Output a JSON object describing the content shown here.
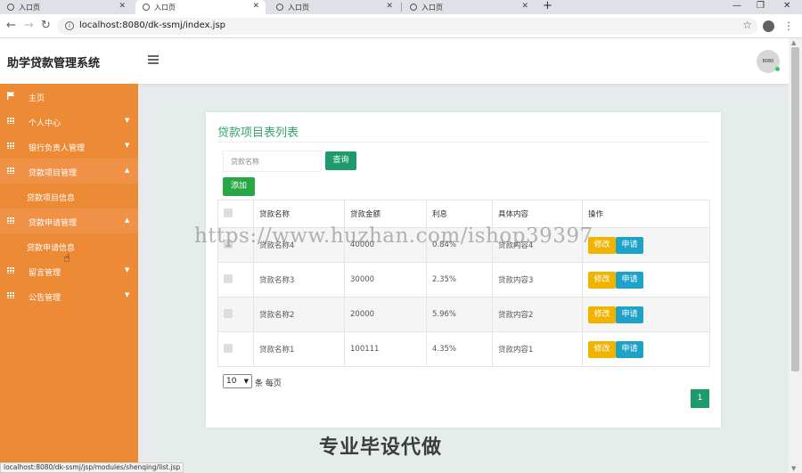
{
  "browser": {
    "tabs": [
      {
        "title": "入口页",
        "active": false
      },
      {
        "title": "入口页",
        "active": true
      },
      {
        "title": "入口页",
        "active": false
      },
      {
        "title": "入口页",
        "active": false
      }
    ],
    "url": "localhost:8080/dk-ssmj/index.jsp",
    "status_url": "localhost:8080/dk-ssmj/jsp/modules/shenqing/list.jsp"
  },
  "header": {
    "brand": "助学贷款管理系统",
    "avatar_text": "8080"
  },
  "sidebar": {
    "items": [
      {
        "label": "主页",
        "icon": "flag-icon"
      },
      {
        "label": "个人中心",
        "icon": "grid-icon"
      },
      {
        "label": "银行负责人管理",
        "icon": "grid-icon"
      },
      {
        "label": "贷款项目管理",
        "icon": "grid-icon",
        "open": true
      },
      {
        "label": "贷款项目信息",
        "sub": true
      },
      {
        "label": "贷款申请管理",
        "icon": "grid-icon",
        "open": true
      },
      {
        "label": "贷款申请信息",
        "sub": true
      },
      {
        "label": "留言管理",
        "icon": "grid-icon"
      },
      {
        "label": "公告管理",
        "icon": "grid-icon"
      }
    ]
  },
  "main": {
    "title": "贷款项目表列表",
    "search_placeholder": "贷款名称",
    "search_button": "查询",
    "add_button": "添加",
    "table": {
      "headers": [
        "",
        "贷款名称",
        "贷款金额",
        "利息",
        "具体内容",
        "操作"
      ],
      "rows": [
        {
          "name": "贷款名称4",
          "amount": "40000",
          "interest": "0.84%",
          "content": "贷款内容4"
        },
        {
          "name": "贷款名称3",
          "amount": "30000",
          "interest": "2.35%",
          "content": "贷款内容3"
        },
        {
          "name": "贷款名称2",
          "amount": "20000",
          "interest": "5.96%",
          "content": "贷款内容2"
        },
        {
          "name": "贷款名称1",
          "amount": "100111",
          "interest": "4.35%",
          "content": "贷款内容1"
        }
      ],
      "edit_label": "修改",
      "apply_label": "申请"
    },
    "page_size": "10",
    "page_size_suffix": "条 每页",
    "current_page": "1"
  },
  "overlay": {
    "watermark": "https://www.huzhan.com/ishop39397",
    "banner": "专业毕设代做"
  },
  "colors": {
    "sidebar": "#ec8a36",
    "title_green": "#34a56f",
    "search_btn": "#1d9b6b",
    "add_btn": "#28a745",
    "edit_btn": "#f0b400",
    "apply_btn": "#1fa2c8"
  }
}
